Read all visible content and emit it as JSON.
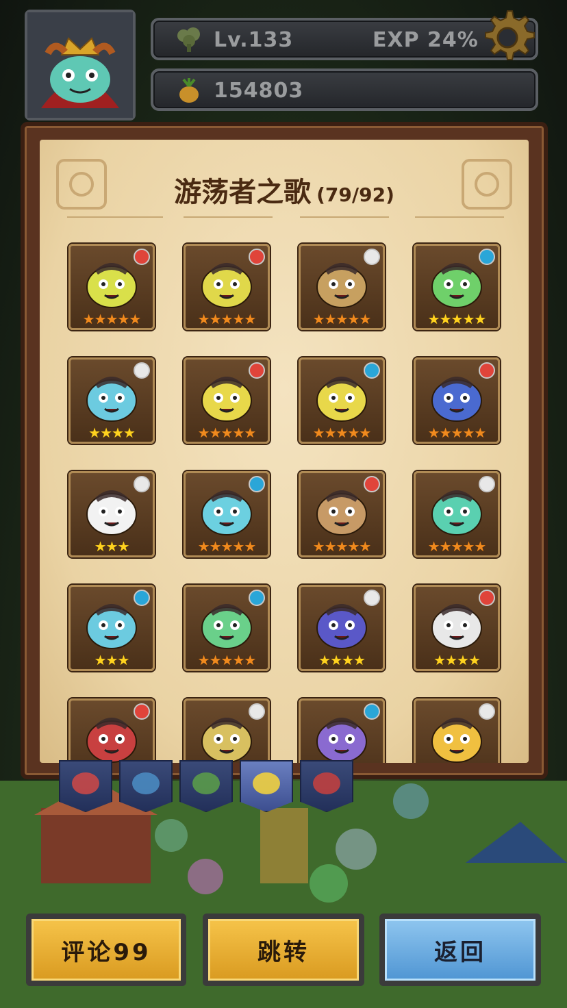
{
  "hud": {
    "level": "Lv.133",
    "exp": "EXP 24%",
    "coins": "154803"
  },
  "panel": {
    "title": "游荡者之歌",
    "count": "(79/92)"
  },
  "cards": [
    {
      "stars": 5,
      "star_color": "orange",
      "badge_color": "#e0443a"
    },
    {
      "stars": 5,
      "star_color": "orange",
      "badge_color": "#e0443a"
    },
    {
      "stars": 5,
      "star_color": "orange",
      "badge_color": "#e8e8e8"
    },
    {
      "stars": 5,
      "star_color": "yellow",
      "badge_color": "#2aa6d8"
    },
    {
      "stars": 4,
      "star_color": "yellow",
      "badge_color": "#e8e8e8"
    },
    {
      "stars": 5,
      "star_color": "orange",
      "badge_color": "#e0443a"
    },
    {
      "stars": 5,
      "star_color": "orange",
      "badge_color": "#2aa6d8"
    },
    {
      "stars": 5,
      "star_color": "orange",
      "badge_color": "#e0443a"
    },
    {
      "stars": 3,
      "star_color": "yellow",
      "badge_color": "#e8e8e8"
    },
    {
      "stars": 5,
      "star_color": "orange",
      "badge_color": "#2aa6d8"
    },
    {
      "stars": 5,
      "star_color": "orange",
      "badge_color": "#e0443a"
    },
    {
      "stars": 5,
      "star_color": "orange",
      "badge_color": "#e8e8e8"
    },
    {
      "stars": 3,
      "star_color": "yellow",
      "badge_color": "#2aa6d8"
    },
    {
      "stars": 5,
      "star_color": "orange",
      "badge_color": "#2aa6d8"
    },
    {
      "stars": 4,
      "star_color": "yellow",
      "badge_color": "#e8e8e8"
    },
    {
      "stars": 4,
      "star_color": "yellow",
      "badge_color": "#e0443a"
    },
    {
      "stars": 0,
      "star_color": "orange",
      "badge_color": "#e0443a"
    },
    {
      "stars": 0,
      "star_color": "orange",
      "badge_color": "#e8e8e8"
    },
    {
      "stars": 0,
      "star_color": "orange",
      "badge_color": "#2aa6d8"
    },
    {
      "stars": 0,
      "star_color": "orange",
      "badge_color": "#e8e8e8"
    }
  ],
  "portrait_colors": [
    "#d9e04a",
    "#e0d84a",
    "#c7a060",
    "#6fd06a",
    "#6ccbe0",
    "#e8d84a",
    "#e8d84a",
    "#4a6ad0",
    "#f2f2f2",
    "#6cd0e0",
    "#c79a66",
    "#5ad0b0",
    "#6ccbe0",
    "#6ad08a",
    "#5a58c8",
    "#e8e8e8",
    "#c84040",
    "#d8c060",
    "#8a6ad0",
    "#f0c040"
  ],
  "tabs": [
    {
      "name": "tab-red-creature",
      "active": false
    },
    {
      "name": "tab-blue-creature",
      "active": false
    },
    {
      "name": "tab-green-creature",
      "active": false
    },
    {
      "name": "tab-gold-trophy",
      "active": true
    },
    {
      "name": "tab-red-monster",
      "active": false
    }
  ],
  "buttons": {
    "comment": "评论99",
    "jump": "跳转",
    "back": "返回"
  },
  "colors": {
    "gold_button": "#f0b838",
    "blue_button": "#6cb0e6",
    "panel_parchment": "#efddb2",
    "star_orange": "#f08a1e",
    "star_yellow": "#ffd21f"
  }
}
